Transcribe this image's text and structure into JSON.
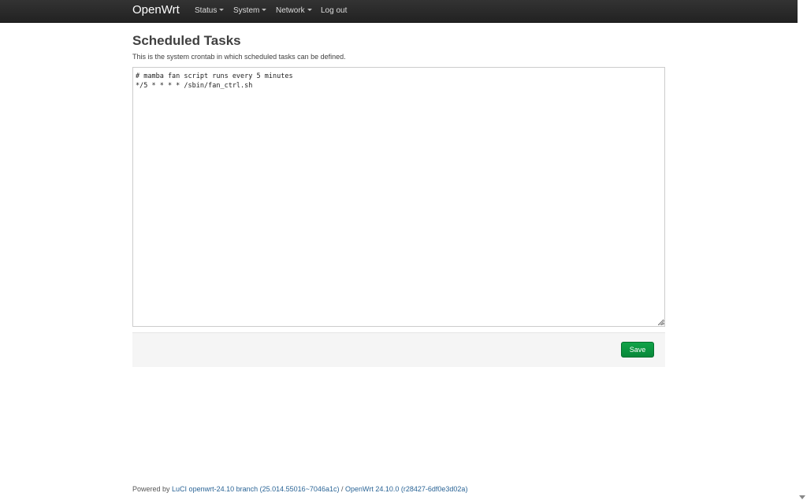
{
  "navbar": {
    "brand": "OpenWrt",
    "items": [
      {
        "label": "Status",
        "dropdown": true
      },
      {
        "label": "System",
        "dropdown": true
      },
      {
        "label": "Network",
        "dropdown": true
      },
      {
        "label": "Log out",
        "dropdown": false
      }
    ]
  },
  "page": {
    "title": "Scheduled Tasks",
    "description": "This is the system crontab in which scheduled tasks can be defined."
  },
  "crontab": {
    "value": "# mamba fan script runs every 5 minutes\n*/5 * * * * /sbin/fan_ctrl.sh"
  },
  "actions": {
    "save_label": "Save"
  },
  "footer": {
    "powered_by": "Powered by",
    "luci_link": "LuCI openwrt-24.10 branch (25.014.55016~7046a1c)",
    "separator": "/",
    "openwrt_link": "OpenWrt 24.10.0 (r28427-6df0e3d02a)"
  },
  "colors": {
    "navbar_bg": "#222222",
    "save_button": "#0b8f3f",
    "link": "#2a6496"
  },
  "icons": {
    "dropdown": "caret-down-icon",
    "scroll_down": "scroll-down-arrow-icon"
  }
}
